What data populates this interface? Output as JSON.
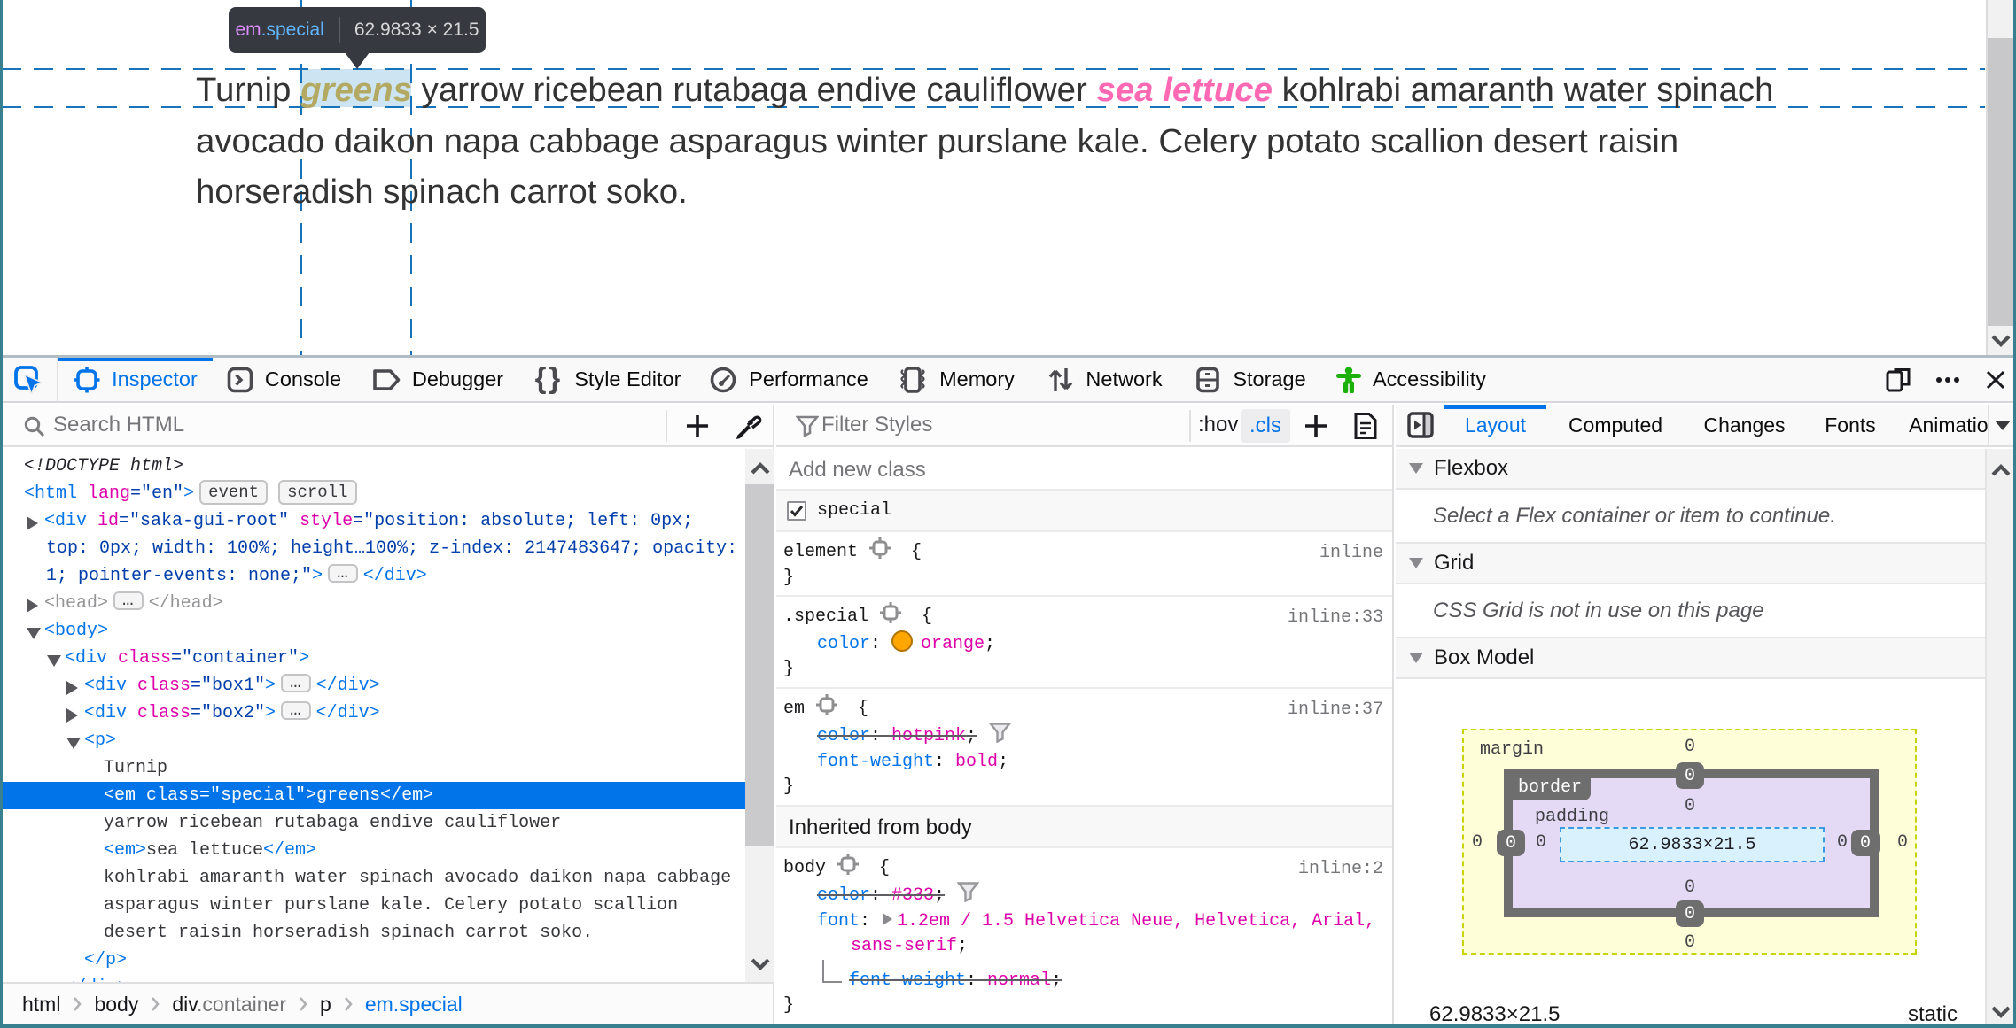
{
  "page": {
    "line1_pre": "Turnip ",
    "line1_em": "greens",
    "line1_mid": " yarrow ricebean rutabaga endive cauliflower ",
    "line1_pink": "sea lettuce",
    "line1_post": " kohlrabi amaranth water spinach",
    "line2": "avocado daikon napa cabbage asparagus winter purslane kale. Celery potato scallion desert raisin",
    "line3": "horseradish spinach carrot soko.",
    "tooltip": {
      "tag": "em",
      "class": ".special",
      "dims": "62.9833 × 21.5"
    }
  },
  "toolbar": {
    "tabs": [
      {
        "id": "inspector",
        "label": "Inspector",
        "active": true
      },
      {
        "id": "console",
        "label": "Console"
      },
      {
        "id": "debugger",
        "label": "Debugger"
      },
      {
        "id": "styleeditor",
        "label": "Style Editor"
      },
      {
        "id": "performance",
        "label": "Performance"
      },
      {
        "id": "memory",
        "label": "Memory"
      },
      {
        "id": "network",
        "label": "Network"
      },
      {
        "id": "storage",
        "label": "Storage"
      },
      {
        "id": "accessibility",
        "label": "Accessibility"
      }
    ]
  },
  "left_panel": {
    "search_placeholder": "Search HTML",
    "tree": [
      {
        "indent": 27,
        "parts": [
          {
            "k": "doctype",
            "t": "<!DOCTYPE html>"
          }
        ]
      },
      {
        "indent": 27,
        "parts": [
          {
            "k": "tag",
            "t": "<html"
          },
          {
            "k": "attr",
            "t": " lang"
          },
          {
            "k": "val",
            "t": "=\"en\""
          },
          {
            "k": "tag",
            "t": ">"
          },
          {
            "k": "badge",
            "t": "event"
          },
          {
            "k": "badge",
            "t": "scroll"
          }
        ]
      },
      {
        "indent": 50,
        "twisty": "closed",
        "parts": [
          {
            "k": "tag",
            "t": "<div"
          },
          {
            "k": "attr",
            "t": " id"
          },
          {
            "k": "val",
            "t": "=\"saka-gui-root\""
          },
          {
            "k": "attr",
            "t": " style"
          },
          {
            "k": "val",
            "t": "=\"position: absolute; left: 0px;"
          }
        ]
      },
      {
        "indent": 52,
        "parts": [
          {
            "k": "val",
            "t": "top: 0px; width: 100%; height…100%; z-index: 2147483647; opacity:"
          }
        ]
      },
      {
        "indent": 52,
        "parts": [
          {
            "k": "val",
            "t": "1; pointer-events: none;\""
          },
          {
            "k": "tag",
            "t": ">"
          },
          {
            "k": "badge",
            "t": "…"
          },
          {
            "k": "tag",
            "t": "</div>"
          }
        ]
      },
      {
        "indent": 50,
        "twisty": "closed",
        "parts": [
          {
            "k": "gray",
            "t": "<head>"
          },
          {
            "k": "badge",
            "t": "…"
          },
          {
            "k": "gray",
            "t": "</head>"
          }
        ]
      },
      {
        "indent": 50,
        "twisty": "open",
        "parts": [
          {
            "k": "tag",
            "t": "<body>"
          }
        ]
      },
      {
        "indent": 73,
        "twisty": "open",
        "parts": [
          {
            "k": "tag",
            "t": "<div"
          },
          {
            "k": "attr",
            "t": " class"
          },
          {
            "k": "val",
            "t": "=\"container\""
          },
          {
            "k": "tag",
            "t": ">"
          }
        ]
      },
      {
        "indent": 95,
        "twisty": "closed",
        "parts": [
          {
            "k": "tag",
            "t": "<div"
          },
          {
            "k": "attr",
            "t": " class"
          },
          {
            "k": "val",
            "t": "=\"box1\""
          },
          {
            "k": "tag",
            "t": ">"
          },
          {
            "k": "badge",
            "t": "…"
          },
          {
            "k": "tag",
            "t": "</div>"
          }
        ]
      },
      {
        "indent": 95,
        "twisty": "closed",
        "parts": [
          {
            "k": "tag",
            "t": "<div"
          },
          {
            "k": "attr",
            "t": " class"
          },
          {
            "k": "val",
            "t": "=\"box2\""
          },
          {
            "k": "tag",
            "t": ">"
          },
          {
            "k": "badge",
            "t": "…"
          },
          {
            "k": "tag",
            "t": "</div>"
          }
        ]
      },
      {
        "indent": 95,
        "twisty": "open",
        "parts": [
          {
            "k": "tag",
            "t": "<p>"
          }
        ]
      },
      {
        "indent": 117,
        "parts": [
          {
            "k": "text",
            "t": "Turnip"
          }
        ]
      },
      {
        "indent": 117,
        "selected": true,
        "parts": [
          {
            "k": "tag",
            "t": "<em"
          },
          {
            "k": "attr",
            "t": " class"
          },
          {
            "k": "val",
            "t": "=\"special\""
          },
          {
            "k": "tag",
            "t": ">"
          },
          {
            "k": "text",
            "t": "greens"
          },
          {
            "k": "tag",
            "t": "</em>"
          }
        ]
      },
      {
        "indent": 117,
        "parts": [
          {
            "k": "text",
            "t": "yarrow ricebean rutabaga endive cauliflower"
          }
        ]
      },
      {
        "indent": 117,
        "parts": [
          {
            "k": "tag",
            "t": "<em>"
          },
          {
            "k": "text",
            "t": "sea lettuce"
          },
          {
            "k": "tag",
            "t": "</em>"
          }
        ]
      },
      {
        "indent": 117,
        "parts": [
          {
            "k": "text",
            "t": "kohlrabi amaranth water spinach avocado daikon napa cabbage"
          }
        ]
      },
      {
        "indent": 117,
        "parts": [
          {
            "k": "text",
            "t": "asparagus winter purslane kale. Celery potato scallion"
          }
        ]
      },
      {
        "indent": 117,
        "parts": [
          {
            "k": "text",
            "t": "desert raisin horseradish spinach carrot soko."
          }
        ]
      },
      {
        "indent": 95,
        "parts": [
          {
            "k": "tag",
            "t": "</p>"
          }
        ]
      },
      {
        "indent": 73,
        "parts": [
          {
            "k": "tag",
            "t": "</div>"
          }
        ]
      }
    ],
    "breadcrumb": [
      {
        "label": "html"
      },
      {
        "label": "body"
      },
      {
        "label": "div",
        "dim": ".container"
      },
      {
        "label": "p"
      },
      {
        "label": "em.special",
        "active": true
      }
    ]
  },
  "rules_panel": {
    "filter_placeholder": "Filter Styles",
    "hov": ":hov",
    "cls": ".cls",
    "add_class": "Add new class",
    "class_toggle": "special",
    "inherited_label": "Inherited from body",
    "rules": [
      {
        "link": "inline",
        "lines": [
          {
            "segs": [
              {
                "k": "sel",
                "t": "element"
              },
              {
                "k": "target"
              },
              {
                "k": "sel",
                "t": " {"
              }
            ]
          },
          {
            "segs": [
              {
                "k": "sel",
                "t": "}"
              }
            ]
          }
        ]
      },
      {
        "link": "inline:33",
        "lines": [
          {
            "segs": [
              {
                "k": "sel",
                "t": ".special"
              },
              {
                "k": "target"
              },
              {
                "k": "sel",
                "t": " {"
              }
            ]
          },
          {
            "ind": 1,
            "segs": [
              {
                "k": "prop",
                "t": "color"
              },
              {
                "k": "punc",
                "t": ": "
              },
              {
                "k": "swatch"
              },
              {
                "k": "val",
                "t": "orange"
              },
              {
                "k": "punc",
                "t": ";"
              }
            ]
          },
          {
            "segs": [
              {
                "k": "sel",
                "t": "}"
              }
            ]
          }
        ]
      },
      {
        "link": "inline:37",
        "lines": [
          {
            "segs": [
              {
                "k": "sel",
                "t": "em"
              },
              {
                "k": "target"
              },
              {
                "k": "sel",
                "t": " {"
              }
            ]
          },
          {
            "ind": 1,
            "strike": true,
            "funnel": true,
            "segs": [
              {
                "k": "prop",
                "t": "color"
              },
              {
                "k": "punc",
                "t": ": "
              },
              {
                "k": "val",
                "t": "hotpink"
              },
              {
                "k": "punc",
                "t": ";"
              }
            ]
          },
          {
            "ind": 1,
            "segs": [
              {
                "k": "prop",
                "t": "font-weight"
              },
              {
                "k": "punc",
                "t": ": "
              },
              {
                "k": "val",
                "t": "bold"
              },
              {
                "k": "punc",
                "t": ";"
              }
            ]
          },
          {
            "segs": [
              {
                "k": "sel",
                "t": "}"
              }
            ]
          }
        ]
      },
      {
        "link": "inline:2",
        "inherited": true,
        "lines": [
          {
            "segs": [
              {
                "k": "sel",
                "t": "body"
              },
              {
                "k": "target"
              },
              {
                "k": "sel",
                "t": " {"
              }
            ]
          },
          {
            "ind": 1,
            "strike": true,
            "funnel": true,
            "segs": [
              {
                "k": "prop",
                "t": "color"
              },
              {
                "k": "punc",
                "t": ": "
              },
              {
                "k": "val",
                "t": "#333"
              },
              {
                "k": "punc",
                "t": ";"
              }
            ]
          },
          {
            "ind": 1,
            "segs": [
              {
                "k": "prop",
                "t": "font"
              },
              {
                "k": "punc",
                "t": ": "
              },
              {
                "k": "twisty"
              },
              {
                "k": "val",
                "t": "1.2em / 1.5 Helvetica Neue, Helvetica, Arial,"
              }
            ]
          },
          {
            "ind": 2,
            "segs": [
              {
                "k": "val",
                "t": "sans-serif"
              },
              {
                "k": "punc",
                "t": ";"
              }
            ]
          },
          {
            "ind": 1,
            "elbow": true,
            "strike": true,
            "segs": [
              {
                "k": "prop",
                "t": "font-weight"
              },
              {
                "k": "punc",
                "t": ": "
              },
              {
                "k": "val",
                "t": "normal"
              },
              {
                "k": "punc",
                "t": ";"
              }
            ]
          },
          {
            "segs": [
              {
                "k": "sel",
                "t": "}"
              }
            ]
          }
        ]
      }
    ]
  },
  "layout_panel": {
    "tabs": [
      {
        "label": "Layout",
        "active": true
      },
      {
        "label": "Computed"
      },
      {
        "label": "Changes"
      },
      {
        "label": "Fonts"
      },
      {
        "label": "Animations"
      }
    ],
    "flexbox_header": "Flexbox",
    "flexbox_message": "Select a Flex container or item to continue.",
    "grid_header": "Grid",
    "grid_message": "CSS Grid is not in use on this page",
    "boxmodel_header": "Box Model",
    "box_model": {
      "margin_label": "margin",
      "border_label": "border",
      "padding_label": "padding",
      "content": "62.9833×21.5",
      "margin": {
        "top": "0",
        "right": "0",
        "bottom": "0",
        "left": "0"
      },
      "border": {
        "top": "0",
        "right": "0",
        "bottom": "0",
        "left": "0"
      },
      "padding": {
        "top": "0",
        "right": "0",
        "bottom": "0",
        "left": "0"
      }
    },
    "footer_size": "62.9833×21.5",
    "footer_position": "static"
  },
  "colors": {
    "accent_blue": "#0074e8",
    "attr_magenta": "#dd00a9",
    "value_navy": "#003eaa",
    "a11y_green": "#1cb00a",
    "window_border": "#38808f",
    "highlight_fill": "#cde5f3",
    "guide_blue": "#1873bd",
    "swatch_orange": "#ffa600"
  }
}
